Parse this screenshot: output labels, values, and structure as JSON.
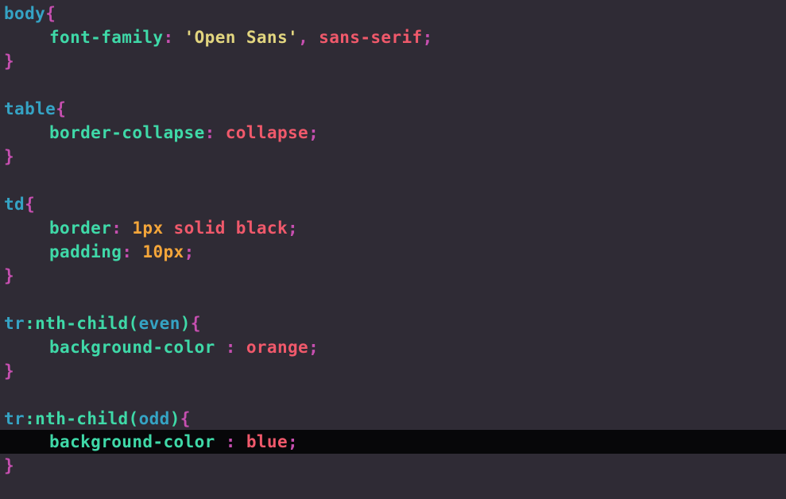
{
  "colors": {
    "background": "#2f2b35",
    "current_line": "#070709",
    "selector": "#35a3c4",
    "brace": "#c64fb0",
    "property": "#3fd9a8",
    "string": "#e2d57f",
    "value": "#f0596b",
    "number": "#f3a53a"
  },
  "code": {
    "body_rule": {
      "selector": "body",
      "open": "{",
      "close": "}",
      "prop1": "font-family",
      "colon1": ":",
      "string1": "'Open Sans'",
      "comma1": ",",
      "value1": "sans-serif",
      "semi1": ";"
    },
    "table_rule": {
      "selector": "table",
      "open": "{",
      "close": "}",
      "prop1": "border-collapse",
      "colon1": ":",
      "value1": "collapse",
      "semi1": ";"
    },
    "td_rule": {
      "selector": "td",
      "open": "{",
      "close": "}",
      "prop1": "border",
      "colon1": ":",
      "num1": "1px",
      "value1": "solid black",
      "semi1": ";",
      "prop2": "padding",
      "colon2": ":",
      "num2": "10px",
      "semi2": ";"
    },
    "even_rule": {
      "selector_tag": "tr",
      "selector_pseudo": ":nth-child(",
      "selector_arg": "even",
      "selector_close": ")",
      "open": "{",
      "close": "}",
      "prop1": "background-color",
      "colon1": " :",
      "value1": "orange",
      "semi1": ";"
    },
    "odd_rule": {
      "selector_tag": "tr",
      "selector_pseudo": ":nth-child(",
      "selector_arg": "odd",
      "selector_close": ")",
      "open": "{",
      "close": "}",
      "prop1": "background-color",
      "colon1": " :",
      "value1": "blue",
      "semi1": ";"
    }
  }
}
